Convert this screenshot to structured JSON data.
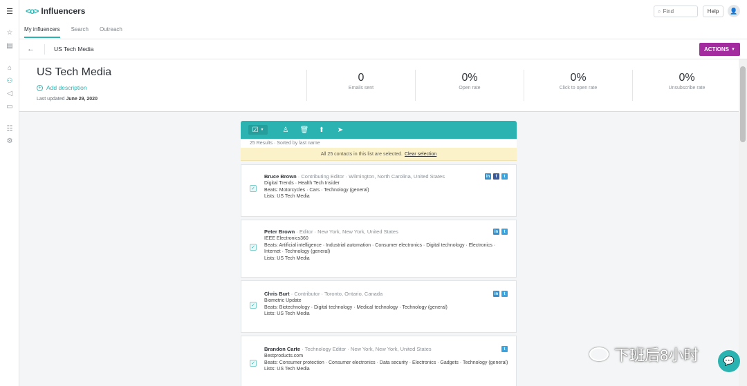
{
  "app": {
    "name": "Influencers"
  },
  "search": {
    "placeholder": "Find"
  },
  "help_label": "Help",
  "tabs": [
    {
      "label": "My influencers"
    },
    {
      "label": "Search"
    },
    {
      "label": "Outreach"
    }
  ],
  "breadcrumb": {
    "current": "US Tech Media"
  },
  "actions_label": "ACTIONS",
  "list": {
    "title": "US Tech Media",
    "add_description": "Add description",
    "updated_prefix": "Last updated",
    "updated_date": "June 29, 2020"
  },
  "stats": [
    {
      "value": "0",
      "label": "Emails sent"
    },
    {
      "value": "0%",
      "label": "Open rate"
    },
    {
      "value": "0%",
      "label": "Click to open rate"
    },
    {
      "value": "0%",
      "label": "Unsubscribe rate"
    }
  ],
  "results": {
    "summary": "25 Results · Sorted by last name",
    "banner_text": "All 25 contacts in this list are selected.",
    "clear_label": "Clear selection"
  },
  "contacts": [
    {
      "name": "Bruce Brown",
      "meta": " · Contributing Editor · Wilmington, North Carolina, United States",
      "outlets": "Digital Trends · Health Tech Insider",
      "beats": "Beats: Motorcycles · Cars · Technology (general)",
      "lists": "Lists: US Tech Media",
      "social": [
        "linkedin",
        "facebook",
        "twitter"
      ]
    },
    {
      "name": "Peter Brown",
      "meta": " · Editor · New York, New York, United States",
      "outlets": "IEEE Electronics360",
      "beats": "Beats: Artificial intelligence · Industrial automation · Consumer electronics · Digital technology · Electronics · Internet · Technology (general)",
      "lists": "Lists: US Tech Media",
      "social": [
        "linkedin",
        "twitter"
      ]
    },
    {
      "name": "Chris Burt",
      "meta": " · Contributor · Toronto, Ontario, Canada",
      "outlets": "Biometric Update",
      "beats": "Beats: Biotechnology · Digital technology · Medical technology · Technology (general)",
      "lists": "Lists: US Tech Media",
      "social": [
        "linkedin",
        "twitter"
      ]
    },
    {
      "name": "Brandon Carte",
      "meta": " · Technology Editor · New York, New York, United States",
      "outlets": "Bestproducts.com",
      "beats": "Beats: Consumer protection · Consumer electronics · Data security · Electronics · Gadgets · Technology (general)",
      "lists": "Lists: US Tech Media",
      "social": [
        "twitter"
      ]
    }
  ],
  "watermark": "下班后8小时",
  "colors": {
    "accent": "#2bb3b1",
    "actions": "#a32b9f",
    "banner": "#fcf2c9"
  }
}
